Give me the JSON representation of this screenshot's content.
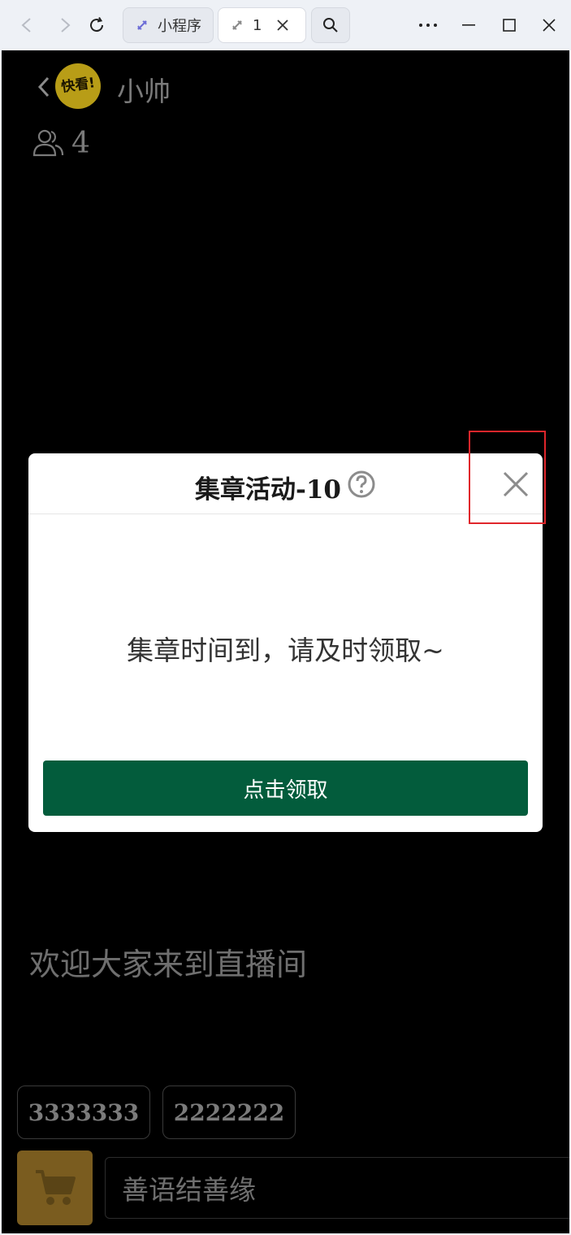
{
  "browser": {
    "tabs": [
      {
        "label": "小程序"
      },
      {
        "label": "1"
      }
    ]
  },
  "header": {
    "username": "小帅",
    "avatar_text": "快看!",
    "viewer_count": "4"
  },
  "main": {
    "welcome_text": "欢迎大家来到直播间",
    "quick_messages": [
      "3333333",
      "2222222"
    ],
    "input_placeholder": "善语结善缘"
  },
  "modal": {
    "title": "集章活动-10",
    "message": "集章时间到，请及时领取~",
    "button_label": "点击领取"
  },
  "colors": {
    "app_background": "#000000",
    "primary_button": "#035c3c",
    "cart_button": "#7a5c1f",
    "highlight": "#e0262b"
  },
  "icons": {
    "back": "chevron-left-icon",
    "viewers": "users-icon",
    "help": "question-circle-icon",
    "close": "close-icon",
    "cart": "shopping-cart-icon"
  }
}
